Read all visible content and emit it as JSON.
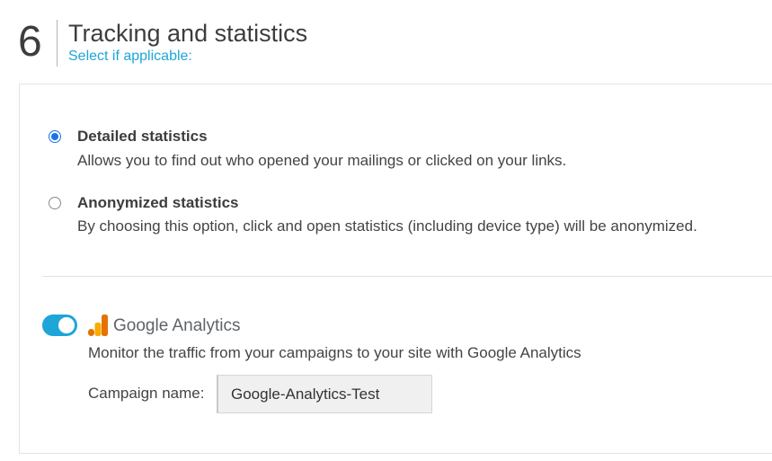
{
  "section": {
    "number": "6",
    "title": "Tracking and statistics",
    "subtitle": "Select if applicable:"
  },
  "options": [
    {
      "title": "Detailed statistics",
      "description": "Allows you to find out who opened your mailings or clicked on your links.",
      "selected": true
    },
    {
      "title": "Anonymized statistics",
      "description": "By choosing this option, click and open statistics (including device type) will be anonymized.",
      "selected": false
    }
  ],
  "google_analytics": {
    "enabled": true,
    "brand_name": "Google Analytics",
    "description": "Monitor the traffic from your campaigns to your site with Google Analytics",
    "campaign_label": "Campaign name:",
    "campaign_value": "Google-Analytics-Test"
  },
  "colors": {
    "accent": "#1ea6d8",
    "radio_selected": "#1a73e8",
    "ga_logo_dark": "#e37400",
    "ga_logo_light": "#f9ab00"
  },
  "icons": {
    "ga_logo": "google-analytics-logo-icon"
  }
}
